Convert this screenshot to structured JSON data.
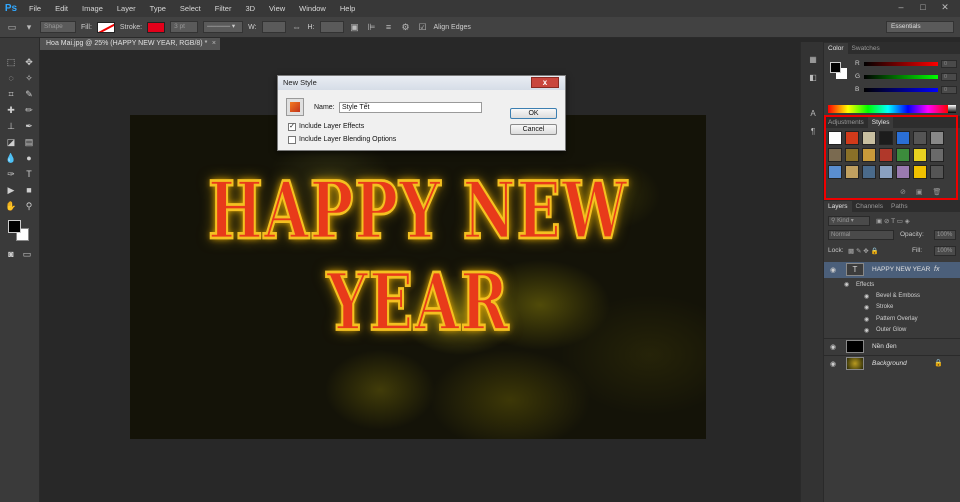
{
  "app": {
    "logo": "Ps"
  },
  "menu": [
    "File",
    "Edit",
    "Image",
    "Layer",
    "Type",
    "Select",
    "Filter",
    "3D",
    "View",
    "Window",
    "Help"
  ],
  "window_controls": {
    "minimize": "–",
    "maximize": "□",
    "close": "✕"
  },
  "options_bar": {
    "shape_mode": "Shape",
    "fill_label": "Fill:",
    "stroke_label": "Stroke:",
    "stroke_width": "3 pt",
    "w_label": "W:",
    "h_label": "H:",
    "align_edges_label": "Align Edges",
    "workspace": "Essentials"
  },
  "document_tab": {
    "title": "Hoa Mai.jpg @ 25% (HAPPY NEW YEAR, RGB/8) *",
    "close": "×"
  },
  "canvas": {
    "text": "HAPPY NEW YEAR"
  },
  "dialog": {
    "title": "New Style",
    "close_glyph": "x",
    "name_label": "Name:",
    "name_value": "Style Tết",
    "include_effects_label": "Include Layer Effects",
    "include_effects_checked": "✓",
    "include_blending_label": "Include Layer Blending Options",
    "ok_label": "OK",
    "cancel_label": "Cancel"
  },
  "color_panel": {
    "tabs": [
      "Color",
      "Swatches"
    ],
    "sliders": [
      {
        "label": "R",
        "value": "0",
        "color": "#c0001a"
      },
      {
        "label": "G",
        "value": "0",
        "color": "#1fa31f"
      },
      {
        "label": "B",
        "value": "0",
        "color": "#2040d0"
      }
    ]
  },
  "styles_panel": {
    "tabs": [
      "Adjustments",
      "Styles"
    ],
    "swatches": [
      "#ffffff",
      "#d23a1a",
      "#c8bfa0",
      "#1c1c1c",
      "#2a6fd6",
      "#555555",
      "#888888",
      "#7a6a50",
      "#8a7028",
      "#c89a3a",
      "#b0382a",
      "#3c8c3c",
      "#e8d020",
      "#6a6a6a",
      "#5a8ed0",
      "#c0a060",
      "#4a6a8a",
      "#8aa0c0",
      "#9a7ab0",
      "#f0c000",
      "#555555"
    ]
  },
  "layers_panel": {
    "tabs": [
      "Layers",
      "Channels",
      "Paths"
    ],
    "kind_label": "Kind",
    "blend_mode": "Normal",
    "opacity_label": "Opacity:",
    "opacity_value": "100%",
    "lock_label": "Lock:",
    "fill_label": "Fill:",
    "fill_value": "100%",
    "layers": [
      {
        "name": "HAPPY NEW YEAR",
        "type": "text",
        "fx": "fx"
      },
      {
        "name": "Nền đen",
        "type": "pixel"
      },
      {
        "name": "Background",
        "type": "image"
      }
    ],
    "effects_label": "Effects",
    "effects": [
      "Bevel & Emboss",
      "Stroke",
      "Pattern Overlay",
      "Outer Glow"
    ]
  }
}
